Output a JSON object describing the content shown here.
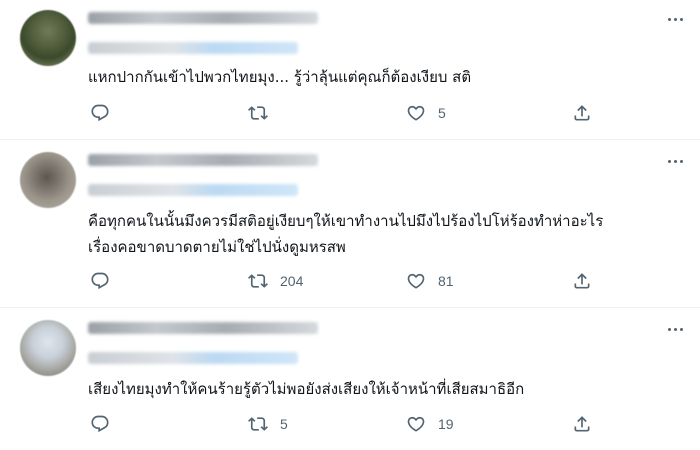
{
  "tweets": [
    {
      "text_lines": [
        "แหกปากกันเข้าไปพวกไทยมุง... รู้ว่าลุ้นแต่คุณก็ต้องเงียบ สติ"
      ],
      "retweets": "",
      "likes": "5"
    },
    {
      "text_lines": [
        "คือทุกคนในนั้นมึงควรมีสติอยู่เงียบๆให้เขาทำงานไปมึงไปร้องไปโห่ร้องทำห่าอะไร",
        "เรื่องคอขาดบาดตายไม่ใช่ไปนั่งดูมหรสพ"
      ],
      "retweets": "204",
      "likes": "81"
    },
    {
      "text_lines": [
        "เสียงไทยมุงทำให้คนร้ายรู้ตัวไม่พอยังส่งเสียงให้เจ้าหน้าที่เสียสมาธิอีก"
      ],
      "retweets": "5",
      "likes": "19"
    }
  ],
  "icons": {
    "reply": "reply-icon",
    "retweet": "retweet-icon",
    "like": "heart-icon",
    "share": "share-icon",
    "more": "more-icon"
  },
  "colors": {
    "icon": "#536471",
    "text": "#0f1419",
    "divider": "#eff3f4"
  }
}
